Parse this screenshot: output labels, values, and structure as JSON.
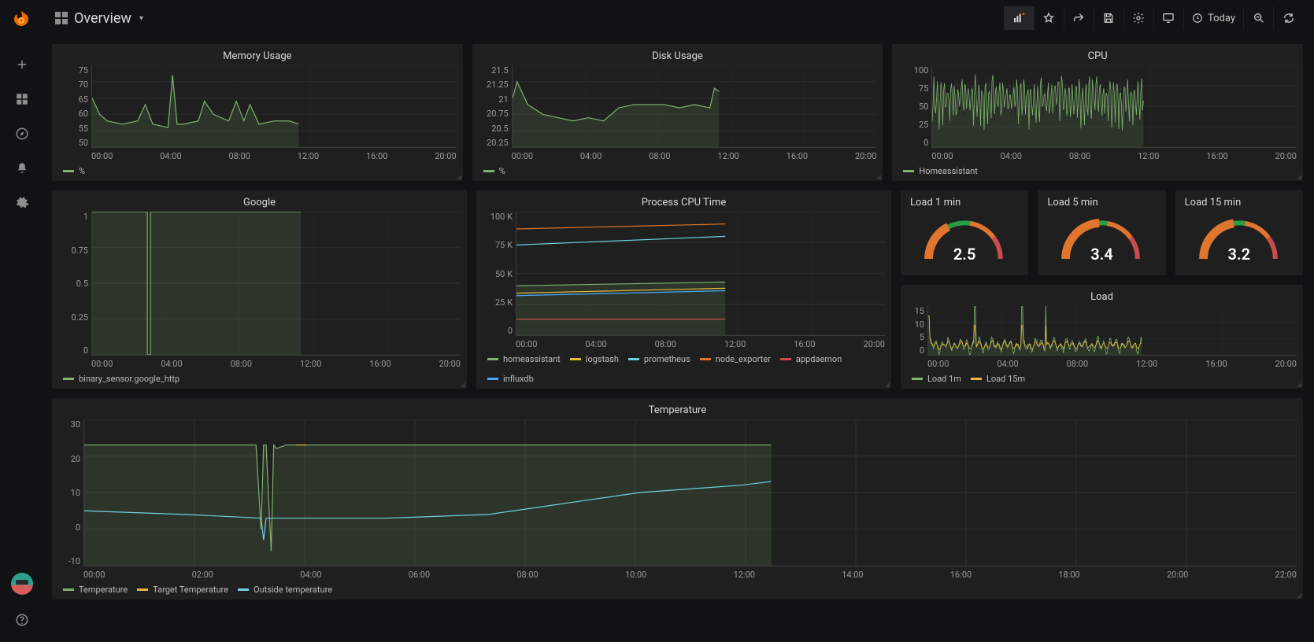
{
  "header": {
    "dashboard_title": "Overview",
    "time_range_label": "Today"
  },
  "sidebar_icons": [
    "plus-icon",
    "dashboards-icon",
    "compass-icon",
    "bell-icon",
    "gear-icon"
  ],
  "chart_data": [
    {
      "id": "memory",
      "type": "line",
      "title": "Memory Usage",
      "xlabel": "",
      "ylabel": "",
      "x_ticks": [
        "00:00",
        "04:00",
        "08:00",
        "12:00",
        "16:00",
        "20:00"
      ],
      "ylim": [
        50,
        75
      ],
      "y_ticks": [
        50,
        55,
        60,
        65,
        70,
        75
      ],
      "series": [
        {
          "name": "%",
          "color": "#7eb26d",
          "x": [
            0,
            0.5,
            1,
            2,
            3,
            3.5,
            4,
            5,
            5.3,
            5.6,
            6,
            7,
            7.4,
            8,
            9,
            9.5,
            10,
            10.4,
            11,
            12,
            13,
            13.6
          ],
          "y": [
            65,
            60,
            58,
            57,
            58,
            63,
            57,
            56,
            72,
            57,
            57,
            58,
            64,
            60,
            58,
            64,
            58,
            63,
            57,
            58,
            58,
            57
          ]
        }
      ],
      "data_end_x_fraction": 0.58,
      "legend": [
        "%"
      ]
    },
    {
      "id": "disk",
      "type": "line",
      "title": "Disk Usage",
      "x_ticks": [
        "00:00",
        "04:00",
        "08:00",
        "12:00",
        "16:00",
        "20:00"
      ],
      "ylim": [
        20.25,
        21.5
      ],
      "y_ticks": [
        20.25,
        20.5,
        20.75,
        21.0,
        21.25,
        21.5
      ],
      "series": [
        {
          "name": "%",
          "color": "#7eb26d",
          "x": [
            0,
            0.3,
            1,
            2,
            3,
            4,
            5,
            6,
            7,
            8,
            9,
            10,
            11,
            12,
            13,
            13.3,
            13.6
          ],
          "y": [
            21.0,
            21.25,
            20.9,
            20.75,
            20.7,
            20.65,
            20.7,
            20.65,
            20.85,
            20.9,
            20.9,
            20.9,
            20.85,
            20.9,
            20.85,
            21.15,
            21.1
          ]
        }
      ],
      "data_end_x_fraction": 0.58,
      "legend": [
        "%"
      ]
    },
    {
      "id": "cpu",
      "type": "line",
      "title": "CPU",
      "x_ticks": [
        "00:00",
        "04:00",
        "08:00",
        "12:00",
        "16:00",
        "20:00"
      ],
      "ylim": [
        0,
        100
      ],
      "y_ticks": [
        0,
        25,
        50,
        75,
        100
      ],
      "series": [
        {
          "name": "Homeassistant",
          "color": "#7eb26d",
          "noisy": true,
          "baseline": 25,
          "amplitude": 40
        }
      ],
      "data_end_x_fraction": 0.58,
      "legend": [
        "Homeassistant"
      ]
    },
    {
      "id": "google",
      "type": "line",
      "title": "Google",
      "x_ticks": [
        "00:00",
        "04:00",
        "08:00",
        "12:00",
        "16:00",
        "20:00"
      ],
      "ylim": [
        0,
        1.0
      ],
      "y_ticks": [
        0,
        0.25,
        0.5,
        0.75,
        1.0
      ],
      "series": [
        {
          "name": "binary_sensor.google_http",
          "color": "#7eb26d",
          "x": [
            0,
            3.6,
            3.6,
            3.8,
            3.8,
            13.6
          ],
          "y": [
            1,
            1,
            0,
            0,
            1,
            1
          ]
        }
      ],
      "data_end_x_fraction": 0.58,
      "legend": [
        "binary_sensor.google_http"
      ]
    },
    {
      "id": "process_cpu",
      "type": "line",
      "title": "Process CPU Time",
      "x_ticks": [
        "00:00",
        "04:00",
        "08:00",
        "12:00",
        "16:00",
        "20:00"
      ],
      "ylim": [
        0,
        100000
      ],
      "y_ticks_labels": [
        "0",
        "25 K",
        "50 K",
        "75 K",
        "100 K"
      ],
      "y_ticks": [
        0,
        25000,
        50000,
        75000,
        100000
      ],
      "series": [
        {
          "name": "homeassistant",
          "color": "#7eb26d",
          "x": [
            0,
            13.6
          ],
          "y": [
            40000,
            43000
          ]
        },
        {
          "name": "logstash",
          "color": "#e5b93e",
          "x": [
            0,
            13.6
          ],
          "y": [
            34000,
            38000
          ]
        },
        {
          "name": "prometheus",
          "color": "#6ed0e0",
          "x": [
            0,
            13.6
          ],
          "y": [
            73000,
            80000
          ]
        },
        {
          "name": "node_exporter",
          "color": "#e0752d",
          "x": [
            0,
            13.6
          ],
          "y": [
            86000,
            90000
          ]
        },
        {
          "name": "appdaemon",
          "color": "#cc4c4c",
          "x": [
            0,
            13.6
          ],
          "y": [
            13000,
            13000
          ]
        },
        {
          "name": "influxdb",
          "color": "#4aa8ff",
          "x": [
            0,
            13.6
          ],
          "y": [
            32000,
            36000
          ]
        }
      ],
      "data_end_x_fraction": 0.58,
      "legend": [
        "homeassistant",
        "logstash",
        "prometheus",
        "node_exporter",
        "appdaemon",
        "influxdb"
      ]
    },
    {
      "id": "load",
      "type": "line",
      "title": "Load",
      "x_ticks": [
        "00:00",
        "04:00",
        "08:00",
        "12:00",
        "16:00",
        "20:00"
      ],
      "ylim": [
        0,
        15
      ],
      "y_ticks": [
        0,
        5,
        10,
        15
      ],
      "series": [
        {
          "name": "Load 1m",
          "color": "#7eb26d",
          "noisy": true,
          "baseline": 3,
          "amplitude": 6
        },
        {
          "name": "Load 15m",
          "color": "#e5b93e",
          "noisy": true,
          "baseline": 3,
          "amplitude": 3
        }
      ],
      "spikes_x_fraction": [
        0.0,
        0.22,
        0.44,
        0.55
      ],
      "data_end_x_fraction": 0.58,
      "legend": [
        "Load 1m",
        "Load 15m"
      ]
    },
    {
      "id": "temperature",
      "type": "line",
      "title": "Temperature",
      "x_ticks": [
        "00:00",
        "02:00",
        "04:00",
        "06:00",
        "08:00",
        "10:00",
        "12:00",
        "14:00",
        "16:00",
        "18:00",
        "20:00",
        "22:00"
      ],
      "ylim": [
        -10,
        30
      ],
      "y_ticks": [
        -10,
        0,
        10,
        20,
        30
      ],
      "series": [
        {
          "name": "Temperature",
          "color": "#7eb26d",
          "x": [
            0,
            3.4,
            3.5,
            3.55,
            3.6,
            3.7,
            3.75,
            3.8,
            4,
            6,
            8,
            10,
            12,
            13.6
          ],
          "y": [
            23,
            23,
            0,
            23,
            23,
            -6,
            23,
            22,
            23,
            23,
            23,
            23,
            23,
            23
          ]
        },
        {
          "name": "Target Temperature",
          "color": "#e5b93e",
          "x": [
            4.2,
            4.4
          ],
          "y": [
            23,
            23
          ]
        },
        {
          "name": "Outside temperature",
          "color": "#6ed0e0",
          "x": [
            0,
            2,
            3.5,
            3.55,
            3.6,
            4,
            6,
            8,
            9,
            10,
            11,
            12,
            13,
            13.6
          ],
          "y": [
            5,
            4,
            3,
            -3,
            3,
            3,
            3,
            4,
            6,
            8,
            10,
            11,
            12,
            13
          ]
        }
      ],
      "data_end_x_fraction": 0.58,
      "legend": [
        "Temperature",
        "Target Temperature",
        "Outside temperature"
      ]
    }
  ],
  "gauges": [
    {
      "title": "Load 1 min",
      "value": "2.5",
      "fraction": 0.35
    },
    {
      "title": "Load 5 min",
      "value": "3.4",
      "fraction": 0.48
    },
    {
      "title": "Load 15 min",
      "value": "3.2",
      "fraction": 0.45
    }
  ]
}
